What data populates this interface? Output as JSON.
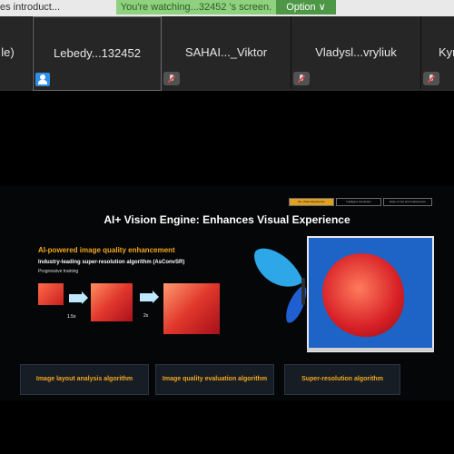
{
  "top_bar": {
    "title": "es introduct...",
    "watch_banner": "You're watching...32452 's screen.",
    "option_label": "Option"
  },
  "participants": [
    {
      "name": "le)"
    },
    {
      "name": "Lebedy...132452",
      "active": true
    },
    {
      "name": "SAHAI..._Viktor"
    },
    {
      "name": "Vladysl...vryliuk"
    },
    {
      "name": "Kyr"
    }
  ],
  "slide": {
    "tabs": [
      "AI+ Vision Experience",
      "Intelligent interaction",
      "Ease of use and maintenance"
    ],
    "title": "AI+ Vision Engine: Enhances Visual Experience",
    "subtitle": "AI-powered image quality enhancement",
    "subheading": "Industry-leading super-resolution algorithm (AsConvSR)",
    "note": "Progressive training",
    "scale_labels": [
      "1.5x",
      "2x"
    ],
    "algorithms": [
      "Image layout analysis algorithm",
      "Image quality evaluation algorithm",
      "Super-resolution algorithm"
    ]
  }
}
